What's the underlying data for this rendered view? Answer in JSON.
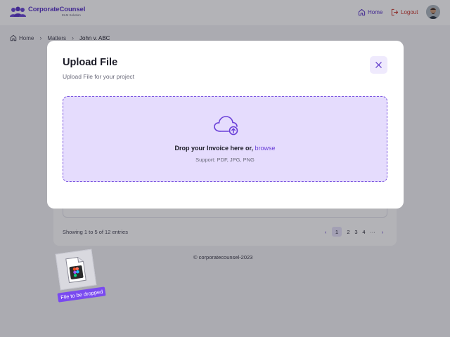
{
  "header": {
    "brand_name": "CorporateCounsel",
    "brand_sub": "ELM Solution",
    "home_label": "Home",
    "logout_label": "Logout"
  },
  "breadcrumb": {
    "items": [
      "Home",
      "Matters",
      "John v. ABC"
    ]
  },
  "table": {
    "showing_text": "Showing 1 to 5 of 12 entries"
  },
  "pagination": {
    "pages": [
      "1",
      "2",
      "3",
      "4"
    ],
    "ellipsis": "···",
    "current": "1"
  },
  "footer": {
    "copyright": "© corporatecounsel-2023"
  },
  "modal": {
    "title": "Upload File",
    "subtitle": "Upload File for your project",
    "drop_text": "Drop your Invoice here or,",
    "browse_label": "browse",
    "support_text": "Support: PDF, JPG, PNG"
  },
  "drag": {
    "tag_label": "File to be dropped"
  },
  "colors": {
    "accent": "#5b36c9",
    "dropzone_bg": "#e5dcfd",
    "logout": "#c7382f",
    "tag_bg": "#7a4af0"
  },
  "icons": {
    "logo": "people-group-icon",
    "home": "home-icon",
    "logout": "logout-icon",
    "close": "close-icon",
    "upload": "cloud-upload-icon",
    "file": "figma-file-icon"
  }
}
